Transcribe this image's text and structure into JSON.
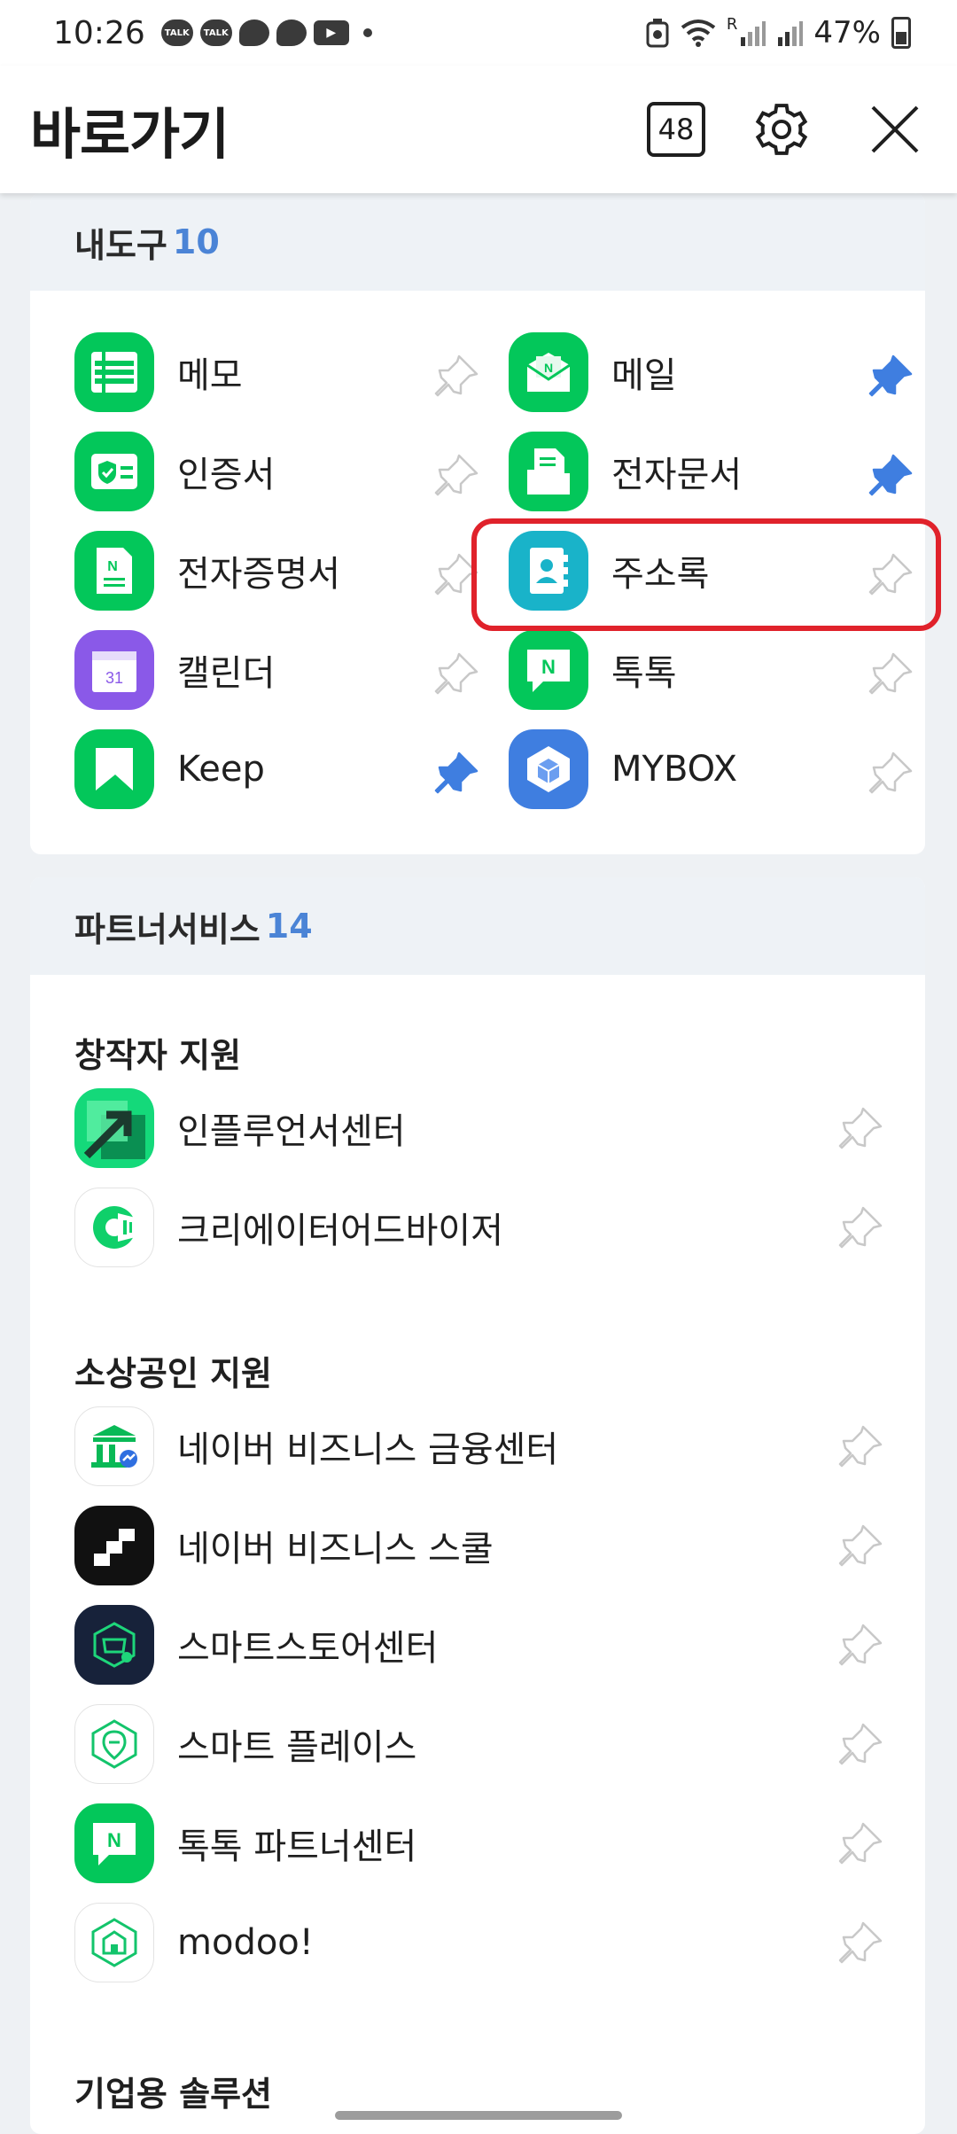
{
  "status_bar": {
    "time": "10:26",
    "battery": "47%",
    "notif_talk": "TALK",
    "sim_r": "R"
  },
  "header": {
    "title": "바로가기",
    "tab_count": "48"
  },
  "my_tools": {
    "title": "내도구",
    "count": "10",
    "items": [
      {
        "label": "메모",
        "icon": "memo-icon",
        "pinned": false
      },
      {
        "label": "메일",
        "icon": "mail-icon",
        "pinned": true
      },
      {
        "label": "인증서",
        "icon": "certificate-icon",
        "pinned": false
      },
      {
        "label": "전자문서",
        "icon": "e-document-icon",
        "pinned": true
      },
      {
        "label": "전자증명서",
        "icon": "e-certificate-icon",
        "pinned": false
      },
      {
        "label": "주소록",
        "icon": "contacts-icon",
        "pinned": false
      },
      {
        "label": "캘린더",
        "icon": "calendar-icon",
        "pinned": false,
        "badge": "31"
      },
      {
        "label": "톡톡",
        "icon": "talktalk-icon",
        "pinned": false
      },
      {
        "label": "Keep",
        "icon": "keep-icon",
        "pinned": true
      },
      {
        "label": "MYBOX",
        "icon": "mybox-icon",
        "pinned": false
      }
    ]
  },
  "partner_services": {
    "title": "파트너서비스",
    "count": "14",
    "sections": [
      {
        "title": "창작자 지원",
        "items": [
          {
            "label": "인플루언서센터",
            "icon": "influencer-icon"
          },
          {
            "label": "크리에이터어드바이저",
            "icon": "creator-advisor-icon"
          }
        ]
      },
      {
        "title": "소상공인 지원",
        "items": [
          {
            "label": "네이버 비즈니스 금융센터",
            "icon": "finance-center-icon"
          },
          {
            "label": "네이버 비즈니스 스쿨",
            "icon": "business-school-icon"
          },
          {
            "label": "스마트스토어센터",
            "icon": "smartstore-icon"
          },
          {
            "label": "스마트 플레이스",
            "icon": "smart-place-icon"
          },
          {
            "label": "톡톡 파트너센터",
            "icon": "talktalk-partner-icon"
          },
          {
            "label": "modoo!",
            "icon": "modoo-icon"
          }
        ]
      },
      {
        "title": "기업용 솔루션",
        "items": []
      }
    ]
  },
  "colors": {
    "naver_green": "#03c75a",
    "pin_blue": "#3f7ee0",
    "count_blue": "#4b84d6",
    "highlight_red": "#e0222b"
  }
}
